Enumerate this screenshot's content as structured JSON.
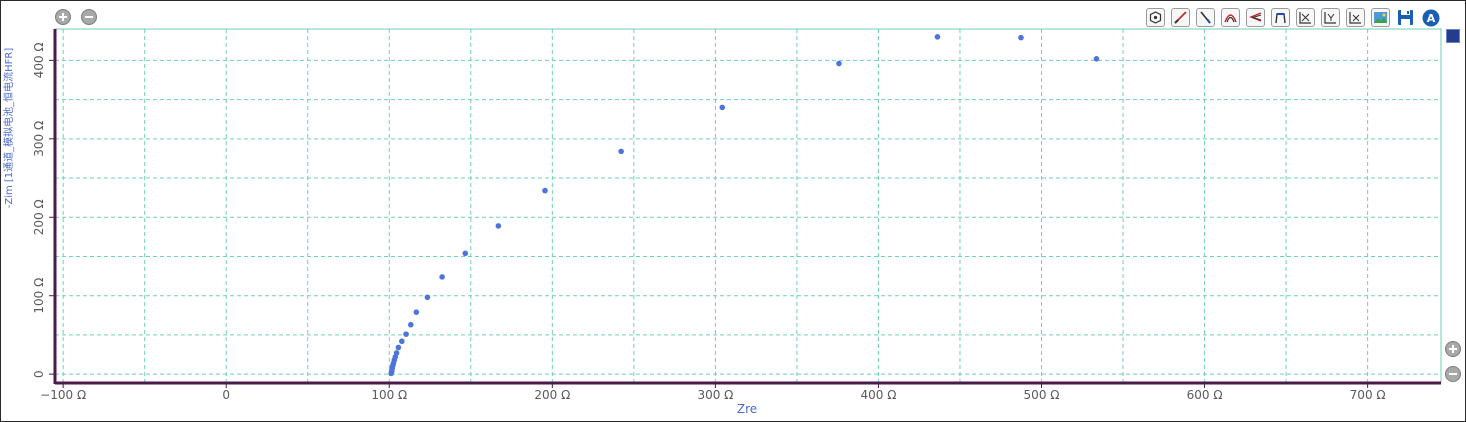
{
  "chart_data": {
    "type": "scatter",
    "title": "",
    "xlabel": "Zre",
    "ylabel": "-Zim [1通道_模拟电池_恒电流HFR]",
    "xlim": [
      -105,
      745
    ],
    "ylim": [
      -10,
      440
    ],
    "x_ticks": [
      -100,
      0,
      100,
      200,
      300,
      400,
      500,
      600,
      700
    ],
    "x_tick_labels": [
      "−100 Ω",
      "0",
      "100 Ω",
      "200 Ω",
      "300 Ω",
      "400 Ω",
      "500 Ω",
      "600 Ω",
      "700 Ω"
    ],
    "y_ticks": [
      0,
      100,
      200,
      300,
      400
    ],
    "y_tick_labels": [
      "0",
      "100 Ω",
      "200 Ω",
      "300 Ω",
      "400 Ω"
    ],
    "grid": true,
    "series": [
      {
        "color": "#4f74d9",
        "x": [
          101.2,
          101.4,
          101.6,
          101.9,
          102.2,
          102.6,
          103.1,
          103.7,
          104.5,
          105.6,
          107.7,
          110.3,
          113.2,
          116.6,
          123.4,
          132.4,
          146.6,
          166.9,
          195.5,
          242.2,
          304.2,
          375.8,
          436.2,
          487.4,
          533.7
        ],
        "y": [
          1,
          3,
          5,
          8,
          11,
          14,
          18,
          22,
          27,
          34,
          42,
          51,
          63,
          79,
          98,
          124,
          154,
          189,
          234,
          284,
          340,
          396,
          430,
          429,
          402
        ]
      }
    ]
  },
  "colors": {
    "grid": "#6fcfb7",
    "left_axis": "#4a1a4a",
    "bottom_axis": "#4a1a4a",
    "points": "#4f74d9",
    "axis_title": "#4a6bd0"
  },
  "toolbar": {
    "icons": [
      "region-select-icon",
      "line-draw-icon",
      "diagonal-line-icon",
      "arc-fit-icon",
      "multi-line-icon",
      "peak-marker-icon",
      "auto-scale-xy-icon",
      "auto-scale-y-icon",
      "auto-scale-x-icon",
      "export-image-icon",
      "save-icon",
      "auto-icon"
    ]
  }
}
